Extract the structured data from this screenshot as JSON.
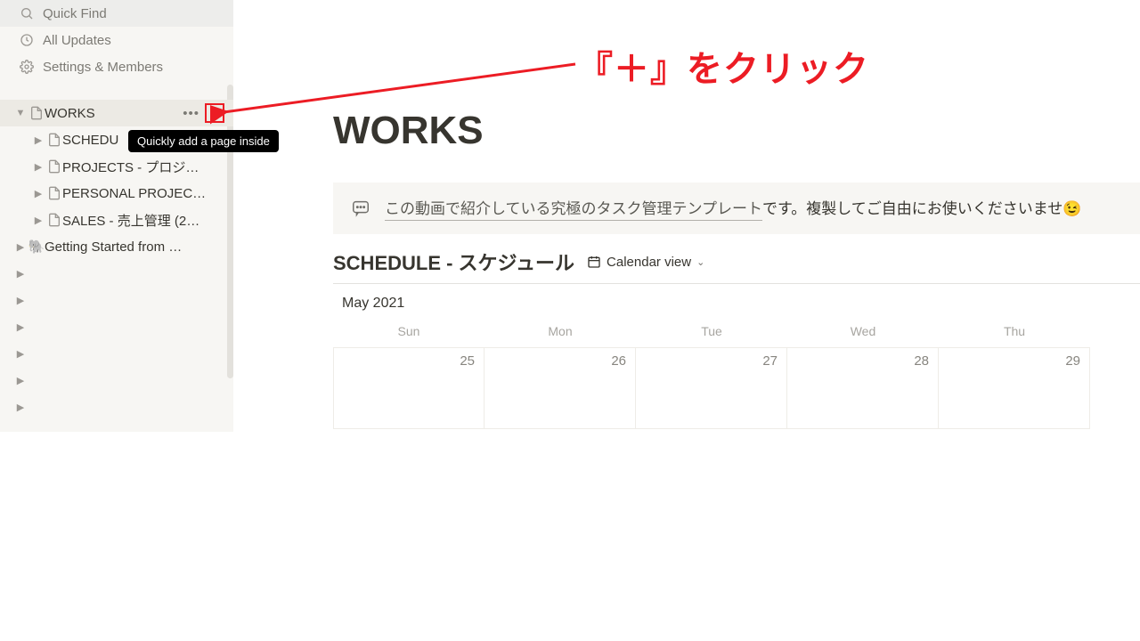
{
  "sidebar": {
    "top": {
      "quick_find": "Quick Find",
      "all_updates": "All Updates",
      "settings": "Settings & Members"
    },
    "works": {
      "label": "WORKS",
      "children": {
        "schedule": "SCHEDU",
        "projects": "PROJECTS - プロジ…",
        "personal": "PERSONAL PROJEC…",
        "sales": "SALES - 売上管理 (2…"
      }
    },
    "getting_started": "Getting Started from …"
  },
  "tooltip": "Quickly add a page inside",
  "annotation": "『＋』をクリック",
  "page": {
    "title": "WORKS",
    "callout_link": "この動画で紹介している究極のタスク管理テンプレート",
    "callout_tail": "です。複製してご自由にお使いくださいませ",
    "db_title": "SCHEDULE - スケジュール",
    "view_label": "Calendar view"
  },
  "calendar": {
    "month": "May 2021",
    "days": {
      "sun": "Sun",
      "mon": "Mon",
      "tue": "Tue",
      "wed": "Wed",
      "thu": "Thu"
    },
    "dates": {
      "d0": "25",
      "d1": "26",
      "d2": "27",
      "d3": "28",
      "d4": "29"
    }
  }
}
